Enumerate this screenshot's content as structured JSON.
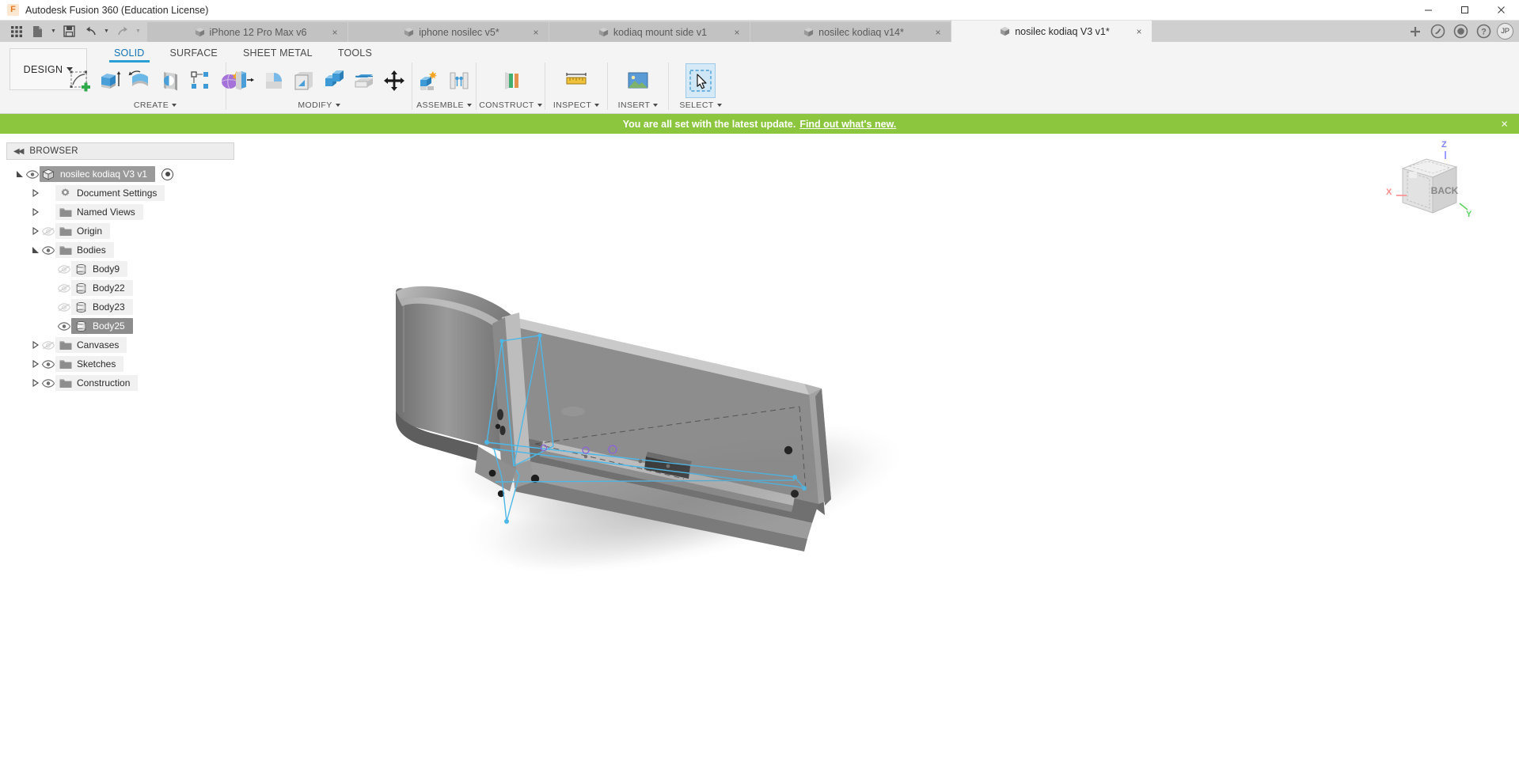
{
  "window": {
    "title": "Autodesk Fusion 360 (Education License)",
    "logo_text": "F",
    "minimize_icon": "minimize-icon",
    "maximize_icon": "maximize-icon",
    "close_icon": "close-icon"
  },
  "quick_access": {
    "grid_icon": "grid-apps-icon",
    "new_icon": "new-document-icon",
    "save_icon": "save-icon",
    "undo_icon": "undo-icon",
    "redo_icon": "redo-icon"
  },
  "doc_tabs": [
    {
      "label": "iPhone 12 Pro Max v6",
      "active": false,
      "close": "×"
    },
    {
      "label": "iphone nosilec v5*",
      "active": false,
      "close": "×"
    },
    {
      "label": "kodiaq mount side v1",
      "active": false,
      "close": "×"
    },
    {
      "label": "nosilec kodiaq v14*",
      "active": false,
      "close": "×"
    },
    {
      "label": "nosilec kodiaq V3 v1*",
      "active": true,
      "close": "×"
    }
  ],
  "tabrow_right": {
    "add_tab": "+",
    "extensions_icon": "extensions-icon",
    "job_status_icon": "job-status-icon",
    "help_icon": "help-icon",
    "avatar_initials": "JP"
  },
  "ribbon": {
    "workspace": "DESIGN",
    "tabs": [
      {
        "label": "SOLID",
        "active": true
      },
      {
        "label": "SURFACE",
        "active": false
      },
      {
        "label": "SHEET METAL",
        "active": false
      },
      {
        "label": "TOOLS",
        "active": false
      }
    ],
    "groups": [
      {
        "label": "CREATE",
        "has_caret": true,
        "tools": [
          {
            "name": "create-sketch-tool",
            "icon": "sketch-plus-icon"
          },
          {
            "name": "extrude-tool",
            "icon": "extrude-icon"
          },
          {
            "name": "revolve-tool",
            "icon": "revolve-icon"
          },
          {
            "name": "sweep-tool",
            "icon": "sweep-icon"
          },
          {
            "name": "pattern-tool",
            "icon": "rectangular-pattern-icon"
          },
          {
            "name": "create-form-tool",
            "icon": "form-sculpt-icon"
          }
        ]
      },
      {
        "label": "MODIFY",
        "has_caret": true,
        "tools": [
          {
            "name": "press-pull-tool",
            "icon": "press-pull-icon"
          },
          {
            "name": "fillet-tool",
            "icon": "fillet-icon"
          },
          {
            "name": "shell-tool",
            "icon": "shell-icon"
          },
          {
            "name": "combine-tool",
            "icon": "combine-icon"
          },
          {
            "name": "offset-face-tool",
            "icon": "offset-face-icon"
          },
          {
            "name": "move-copy-tool",
            "icon": "move-copy-icon"
          }
        ]
      },
      {
        "label": "ASSEMBLE",
        "has_caret": true,
        "tools": [
          {
            "name": "new-component-tool",
            "icon": "new-component-icon"
          },
          {
            "name": "joint-tool",
            "icon": "joint-icon"
          }
        ]
      },
      {
        "label": "CONSTRUCT",
        "has_caret": true,
        "tools": [
          {
            "name": "offset-plane-tool",
            "icon": "offset-plane-icon"
          }
        ]
      },
      {
        "label": "INSPECT",
        "has_caret": true,
        "tools": [
          {
            "name": "measure-tool",
            "icon": "measure-ruler-icon"
          }
        ]
      },
      {
        "label": "INSERT",
        "has_caret": true,
        "tools": [
          {
            "name": "insert-canvas-tool",
            "icon": "insert-image-icon"
          }
        ]
      },
      {
        "label": "SELECT",
        "has_caret": true,
        "tools": [
          {
            "name": "select-tool",
            "icon": "cursor-select-icon",
            "selected": true
          }
        ]
      }
    ]
  },
  "banner": {
    "text": "You are all set with the latest update.",
    "link": "Find out what's new.",
    "close": "×",
    "color": "#8cc63e"
  },
  "browser": {
    "header": "BROWSER",
    "collapse_icon": "collapse-left-icon",
    "nodes": [
      {
        "label": "nosilec kodiaq V3 v1",
        "indent": 0,
        "twisty": "expanded",
        "eye": "visible",
        "icon": "component-icon",
        "style": "root",
        "has_activate_dot": true
      },
      {
        "label": "Document Settings",
        "indent": 1,
        "twisty": "collapsed",
        "eye": "none",
        "icon": "gear-icon",
        "style": "normal"
      },
      {
        "label": "Named Views",
        "indent": 1,
        "twisty": "collapsed",
        "eye": "none",
        "icon": "folder-icon",
        "style": "normal"
      },
      {
        "label": "Origin",
        "indent": 1,
        "twisty": "collapsed",
        "eye": "hidden",
        "icon": "folder-icon",
        "style": "normal"
      },
      {
        "label": "Bodies",
        "indent": 1,
        "twisty": "expanded",
        "eye": "visible",
        "icon": "folder-icon",
        "style": "normal"
      },
      {
        "label": "Body9",
        "indent": 2,
        "twisty": "none",
        "eye": "hidden",
        "icon": "body-icon",
        "style": "normal"
      },
      {
        "label": "Body22",
        "indent": 2,
        "twisty": "none",
        "eye": "hidden",
        "icon": "body-icon",
        "style": "normal"
      },
      {
        "label": "Body23",
        "indent": 2,
        "twisty": "none",
        "eye": "hidden",
        "icon": "body-icon",
        "style": "normal"
      },
      {
        "label": "Body25",
        "indent": 2,
        "twisty": "none",
        "eye": "visible",
        "icon": "body-icon",
        "style": "selected"
      },
      {
        "label": "Canvases",
        "indent": 1,
        "twisty": "collapsed",
        "eye": "hidden",
        "icon": "folder-icon",
        "style": "normal"
      },
      {
        "label": "Sketches",
        "indent": 1,
        "twisty": "collapsed",
        "eye": "visible",
        "icon": "folder-icon",
        "style": "normal"
      },
      {
        "label": "Construction",
        "indent": 1,
        "twisty": "collapsed",
        "eye": "visible",
        "icon": "folder-icon",
        "style": "normal"
      }
    ]
  },
  "viewcube": {
    "face_label": "BACK",
    "axis_x": "X",
    "axis_y": "Y",
    "axis_z": "Z",
    "color_x": "#ff8a8a",
    "color_y": "#5fd35f",
    "color_z": "#8080ff"
  },
  "canvas": {
    "model_name": "phone-mount-3d-model",
    "background": "#ffffff",
    "sketch_color": "#4db8e8"
  }
}
